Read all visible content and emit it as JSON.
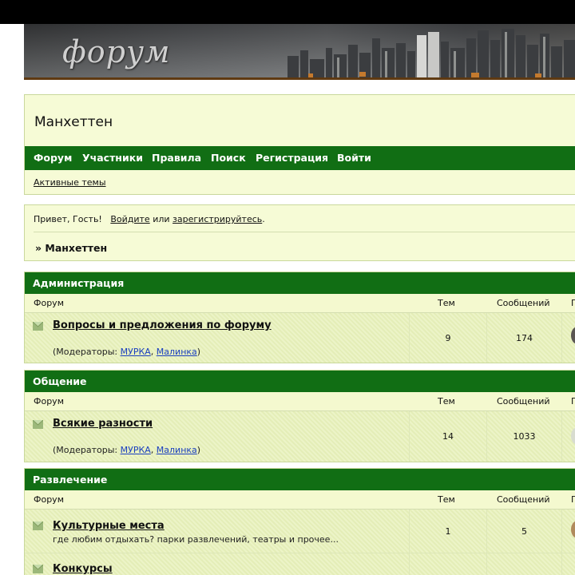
{
  "banner": {
    "logo_text": "форум"
  },
  "forum": {
    "title": "Манхеттен"
  },
  "nav": {
    "items": [
      "Форум",
      "Участники",
      "Правила",
      "Поиск",
      "Регистрация",
      "Войти"
    ],
    "active_topics": "Активные темы"
  },
  "greeting": {
    "prefix": "Привет, Гость!",
    "login_link": "Войдите",
    "or": "или",
    "register_link": "зарегистрируйтесь",
    "suffix": "."
  },
  "breadcrumb": "» Манхеттен",
  "columns": {
    "forum": "Форум",
    "topics": "Тем",
    "posts": "Сообщений",
    "last": "П"
  },
  "categories": [
    {
      "name": "Администрация",
      "forums": [
        {
          "name": "Вопросы и предложения по форуму",
          "topics": "9",
          "posts": "174",
          "mods_prefix": "(Модераторы: ",
          "mods": [
            "МУРКА",
            "Малинка"
          ],
          "mods_suffix": ")"
        }
      ]
    },
    {
      "name": "Общение",
      "forums": [
        {
          "name": "Всякие разности",
          "topics": "14",
          "posts": "1033",
          "mods_prefix": "(Модераторы: ",
          "mods": [
            "МУРКА",
            "Малинка"
          ],
          "mods_suffix": ")"
        }
      ]
    },
    {
      "name": "Развлечение",
      "forums": [
        {
          "name": "Культурные места",
          "description": "где любим отдыхать? парки развлечений, театры и прочее...",
          "topics": "1",
          "posts": "5"
        },
        {
          "name": "Конкурсы"
        }
      ]
    }
  ],
  "colors": {
    "nav_green": "#116e14",
    "panel_bg": "#f6fbd6",
    "link_blue": "#1a3fbf"
  },
  "icons": {
    "forum_icon": "forum-envelope-icon"
  }
}
